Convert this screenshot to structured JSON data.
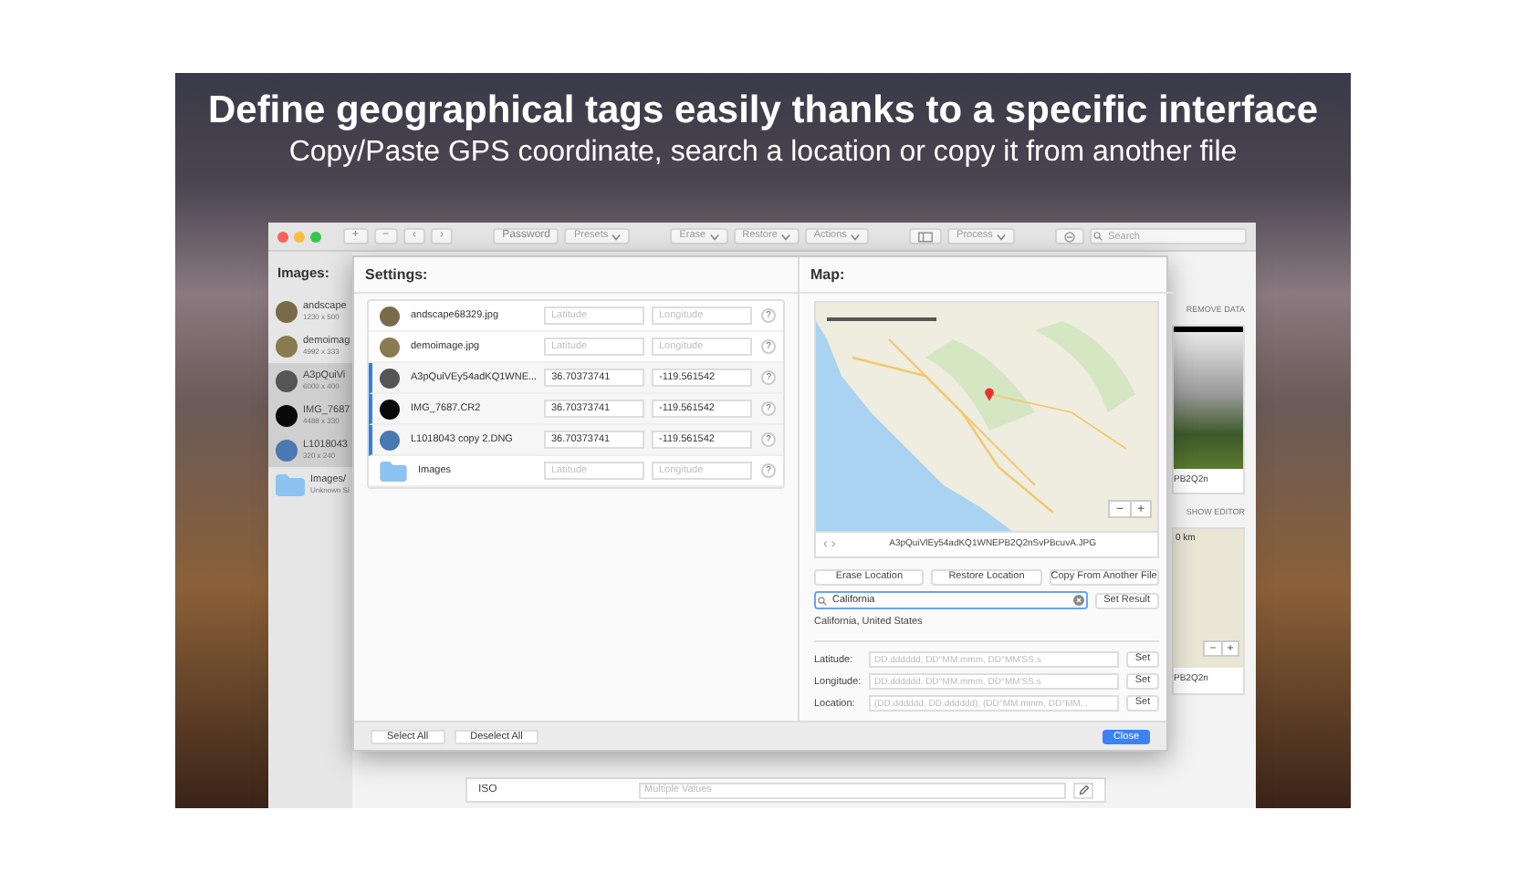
{
  "banner": {
    "title": "Define geographical tags easily thanks to a specific interface",
    "subtitle": "Copy/Paste GPS coordinate, search a location or copy it from another file"
  },
  "toolbar": [
    {
      "kind": "text",
      "label": "+"
    },
    {
      "kind": "text",
      "label": "−"
    },
    {
      "kind": "text",
      "label": "‹"
    },
    {
      "kind": "text",
      "label": "›"
    },
    {
      "kind": "text",
      "label": "Password"
    },
    {
      "kind": "dropdown",
      "label": "Presets"
    },
    {
      "kind": "dropdown",
      "label": "Erase"
    },
    {
      "kind": "dropdown",
      "label": "Restore"
    },
    {
      "kind": "dropdown",
      "label": "Actions"
    },
    {
      "kind": "icon"
    },
    {
      "kind": "dropdown",
      "label": "Process"
    },
    {
      "kind": "icon"
    },
    {
      "kind": "search",
      "placeholder": "Search"
    }
  ],
  "sidebar": {
    "title": "Images:",
    "items": [
      {
        "kind": "photo",
        "name": "andscape",
        "dims": "1230 x 500",
        "selected": false,
        "color": "#7a6a4a"
      },
      {
        "kind": "photo",
        "name": "demoimag",
        "dims": "4992 x 333",
        "selected": false,
        "color": "#8a7a50"
      },
      {
        "kind": "photo",
        "name": "A3pQuiVi",
        "dims": "6000 x 400",
        "selected": true,
        "color": "#555555"
      },
      {
        "kind": "photo",
        "name": "IMG_7687",
        "dims": "4488 x 330",
        "selected": true,
        "color": "#0a0a0a"
      },
      {
        "kind": "photo",
        "name": "L1018043",
        "dims": "320 x 240",
        "selected": true,
        "color": "#4a78b0"
      },
      {
        "kind": "folder",
        "name": "Images/",
        "dims": "Unknown Si",
        "selected": false
      }
    ]
  },
  "right_panel": {
    "remove_data": "REMOVE DATA",
    "caption": "PB2Q2n",
    "show_editor": "SHOW EDITOR",
    "scale": "0 km",
    "zoom_out": "−",
    "zoom_in": "+",
    "caption_2": "PB2Q2n"
  },
  "iso_row": {
    "label": "ISO",
    "placeholder": "Multiple Values"
  },
  "settings": {
    "title": "Settings:",
    "rows": [
      {
        "kind": "photo",
        "name": "andscape68329.jpg",
        "selected": false,
        "color": "#7a6a4a",
        "latitude": {
          "placeholder": "Latitude"
        },
        "longitude": {
          "placeholder": "Longitude"
        },
        "help": "?"
      },
      {
        "kind": "photo",
        "name": "demoimage.jpg",
        "selected": false,
        "color": "#8a7a50",
        "latitude": {
          "placeholder": "Latitude"
        },
        "longitude": {
          "placeholder": "Longitude"
        },
        "help": "?"
      },
      {
        "kind": "photo",
        "name": "A3pQuiVEy54adKQ1WNE...",
        "selected": true,
        "color": "#555555",
        "latitude": {
          "value": "36.70373741"
        },
        "longitude": {
          "value": "-119.561542"
        },
        "help": "?"
      },
      {
        "kind": "photo",
        "name": "IMG_7687.CR2",
        "selected": true,
        "color": "#0a0a0a",
        "latitude": {
          "value": "36.70373741"
        },
        "longitude": {
          "value": "-119.561542"
        },
        "help": "?"
      },
      {
        "kind": "photo",
        "name": "L1018043 copy 2.DNG",
        "selected": true,
        "color": "#4a78b0",
        "latitude": {
          "value": "36.70373741"
        },
        "longitude": {
          "value": "-119.561542"
        },
        "help": "?"
      },
      {
        "kind": "folder",
        "name": "Images",
        "selected": false,
        "latitude": {
          "placeholder": "Latitude"
        },
        "longitude": {
          "placeholder": "Longitude"
        },
        "help": "?"
      }
    ]
  },
  "map_pane": {
    "title": "Map:",
    "zoom_out": "−",
    "zoom_in": "+",
    "nav_prev": "‹",
    "nav_next": "›",
    "filename": "A3pQuiVlEy54adKQ1WNEPB2Q2nSvPBcuvA.JPG",
    "actions": [
      "Erase Location",
      "Restore Location",
      "Copy From Another File"
    ],
    "search": {
      "value": "California"
    },
    "set_result": "Set Result",
    "result": "California, United States",
    "coordinates": [
      {
        "label": "Latitude:",
        "placeholder": "DD.dddddd, DD°MM.mmm, DD°MM'SS.s",
        "button": "Set"
      },
      {
        "label": "Longitude:",
        "placeholder": "DD.dddddd, DD°MM.mmm, DD°MM'SS.s",
        "button": "Set"
      },
      {
        "label": "Location:",
        "placeholder": "(DD.dddddd, DD.dddddd), (DD°MM.mmm, DD°MM...",
        "button": "Set"
      }
    ]
  },
  "footer": [
    {
      "kind": "plain",
      "label": "Select All"
    },
    {
      "kind": "plain",
      "label": "Deselect All"
    },
    {
      "kind": "primary",
      "label": "Close"
    }
  ]
}
